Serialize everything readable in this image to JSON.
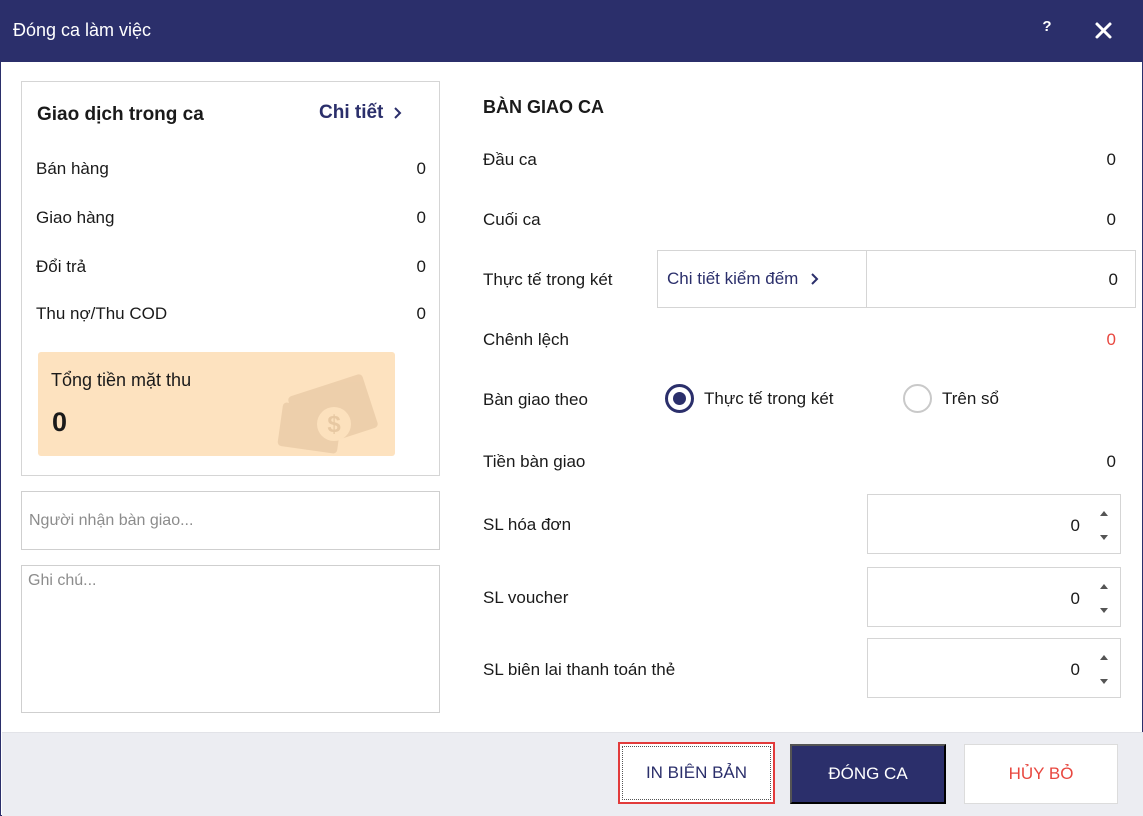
{
  "window": {
    "title": "Đóng ca làm việc",
    "help": "?"
  },
  "transactions": {
    "title": "Giao dịch trong ca",
    "detail_link": "Chi tiết",
    "rows": [
      {
        "label": "Bán hàng",
        "value": "0"
      },
      {
        "label": "Giao hàng",
        "value": "0"
      },
      {
        "label": "Đổi trả",
        "value": "0"
      },
      {
        "label": "Thu nợ/Thu COD",
        "value": "0"
      }
    ],
    "cash_total_label": "Tổng tiền mặt thu",
    "cash_total_value": "0"
  },
  "receiver": {
    "placeholder": "Người nhận bàn giao...",
    "value": ""
  },
  "note": {
    "placeholder": "Ghi chú...",
    "value": ""
  },
  "handover": {
    "title": "BÀN GIAO CA",
    "opening_label": "Đầu ca",
    "opening_value": "0",
    "closing_label": "Cuối ca",
    "closing_value": "0",
    "actual_label": "Thực tế trong két",
    "count_detail_link": "Chi tiết kiểm đếm",
    "actual_value": "0",
    "difference_label": "Chênh lệch",
    "difference_value": "0",
    "handover_by_label": "Bàn giao theo",
    "handover_options": [
      {
        "label": "Thực tế trong két",
        "selected": true
      },
      {
        "label": "Trên sổ",
        "selected": false
      }
    ],
    "handover_amount_label": "Tiền bàn giao",
    "handover_amount_value": "0",
    "invoice_count_label": "SL hóa đơn",
    "invoice_count_value": "0",
    "voucher_count_label": "SL voucher",
    "voucher_count_value": "0",
    "card_receipt_count_label": "SL biên lai thanh toán thẻ",
    "card_receipt_count_value": "0"
  },
  "buttons": {
    "print": "IN BIÊN BẢN",
    "close_shift": "ĐÓNG CA",
    "cancel": "HỦY BỎ"
  },
  "colors": {
    "primary": "#2b2f6b",
    "danger": "#e8473f",
    "cash_card_bg": "#fde2bf",
    "footer_bg": "#ecedf2"
  },
  "icons": [
    "help-icon",
    "close-icon",
    "chevron-right-icon",
    "money-icon",
    "spinner-up-icon",
    "spinner-down-icon"
  ]
}
